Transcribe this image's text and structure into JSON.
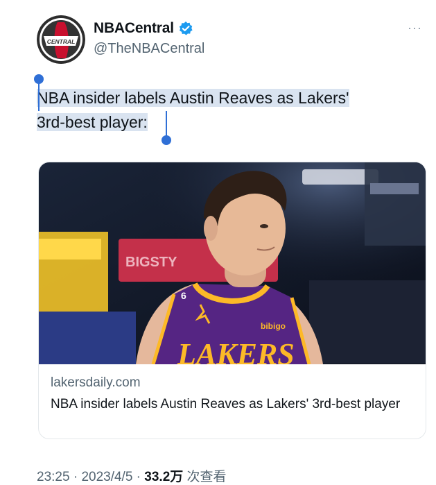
{
  "author": {
    "avatar_text": "CENTRAL",
    "display_name": "NBACentral",
    "handle": "@TheNBACentral",
    "verified": true,
    "more_label": "···"
  },
  "tweet": {
    "text_line1": "NBA insider labels Austin Reaves as Lakers'",
    "text_line2": "3rd-best player:"
  },
  "card": {
    "image_jersey_text": "LAKERS",
    "image_number": "6",
    "image_sponsor": "bibigo",
    "image_sign_text": "BIGSTY",
    "domain": "lakersdaily.com",
    "title": "NBA insider labels Austin Reaves as Lakers' 3rd-best player"
  },
  "footer": {
    "time": "23:25",
    "sep1": " · ",
    "date": "2023/4/5",
    "sep2": " · ",
    "views": "33.2万",
    "views_label": " 次查看"
  },
  "colors": {
    "selection": "#d9e3f0",
    "selection_handle": "#2f6fd6",
    "verified_blue": "#1d9bf0",
    "lakers_purple": "#552583",
    "lakers_gold": "#fdb927"
  },
  "icons": [
    "verified-badge-icon",
    "more-options-icon"
  ]
}
